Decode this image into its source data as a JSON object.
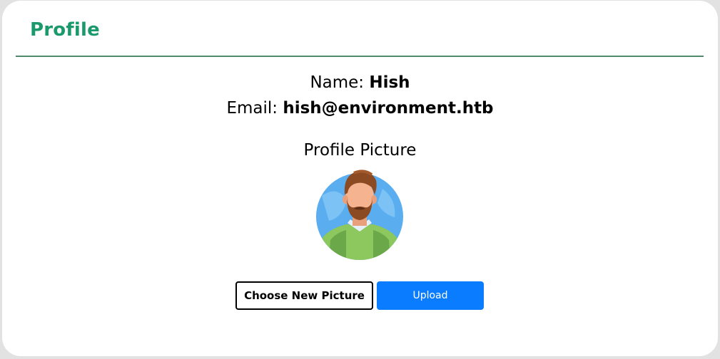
{
  "profile": {
    "title": "Profile",
    "name_label": "Name:",
    "name_value": "Hish",
    "email_label": "Email:",
    "email_value": "hish@environment.htb",
    "picture_title": "Profile Picture",
    "avatar_icon": "man-beard-avatar-icon"
  },
  "actions": {
    "choose_label": "Choose New Picture",
    "upload_label": "Upload"
  },
  "colors": {
    "title": "#1a9a6c",
    "divider": "#4f8a6f",
    "upload_button": "#0a7cff",
    "avatar_bg": "#5aaef0"
  }
}
